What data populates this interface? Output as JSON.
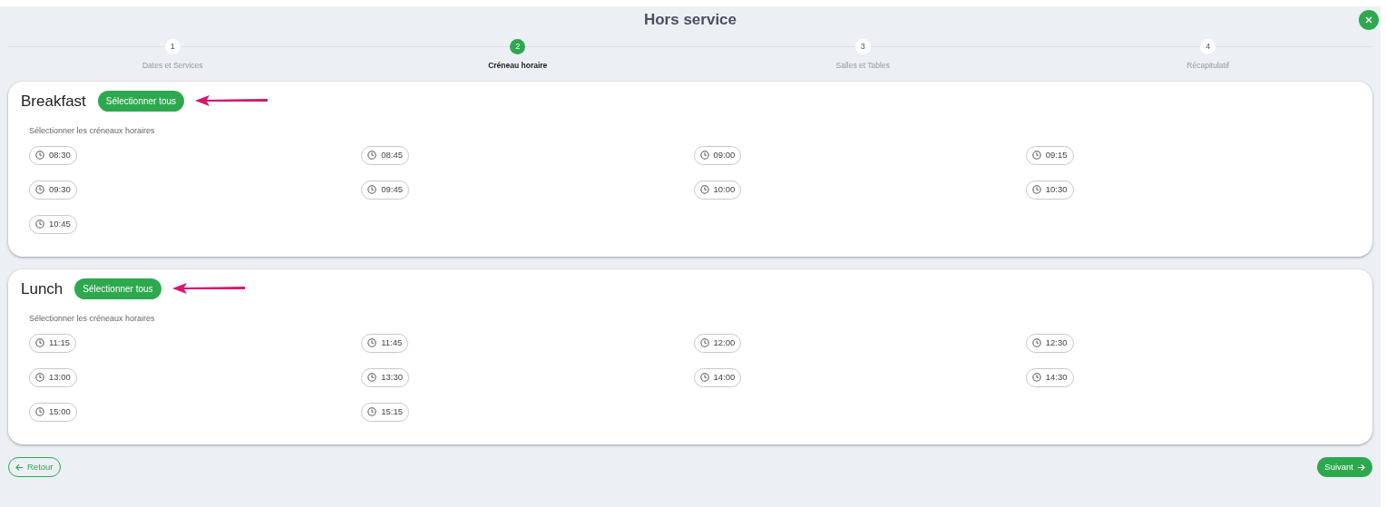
{
  "title": "Hors service",
  "steps": [
    {
      "number": "1",
      "label": "Dates et Services",
      "selected": false
    },
    {
      "number": "2",
      "label": "Créneau horaire",
      "selected": true
    },
    {
      "number": "3",
      "label": "Salles et Tables",
      "selected": false
    },
    {
      "number": "4",
      "label": "Récapitulatif",
      "selected": false
    }
  ],
  "services": [
    {
      "name": "Breakfast",
      "select_all": "Sélectionner tous",
      "prompt": "Sélectionner les créneaux horaires",
      "slots": [
        {
          "time": "08:30",
          "selected": false
        },
        {
          "time": "08:45",
          "selected": false
        },
        {
          "time": "09:00",
          "selected": false
        },
        {
          "time": "09:15",
          "selected": false
        },
        {
          "time": "09:30",
          "selected": false
        },
        {
          "time": "09:45",
          "selected": false
        },
        {
          "time": "10:00",
          "selected": false
        },
        {
          "time": "10:30",
          "selected": false
        },
        {
          "time": "10:45",
          "selected": false
        }
      ]
    },
    {
      "name": "Lunch",
      "select_all": "Sélectionner tous",
      "prompt": "Sélectionner les créneaux horaires",
      "slots": [
        {
          "time": "11:15",
          "selected": false
        },
        {
          "time": "11:45",
          "selected": false
        },
        {
          "time": "12:00",
          "selected": false
        },
        {
          "time": "12:30",
          "selected": false
        },
        {
          "time": "13:00",
          "selected": false
        },
        {
          "time": "13:30",
          "selected": false
        },
        {
          "time": "14:00",
          "selected": false
        },
        {
          "time": "14:30",
          "selected": false
        },
        {
          "time": "15:00",
          "selected": false
        },
        {
          "time": "15:15",
          "selected": false
        }
      ]
    }
  ],
  "back": "Retour",
  "next": "Suivant"
}
